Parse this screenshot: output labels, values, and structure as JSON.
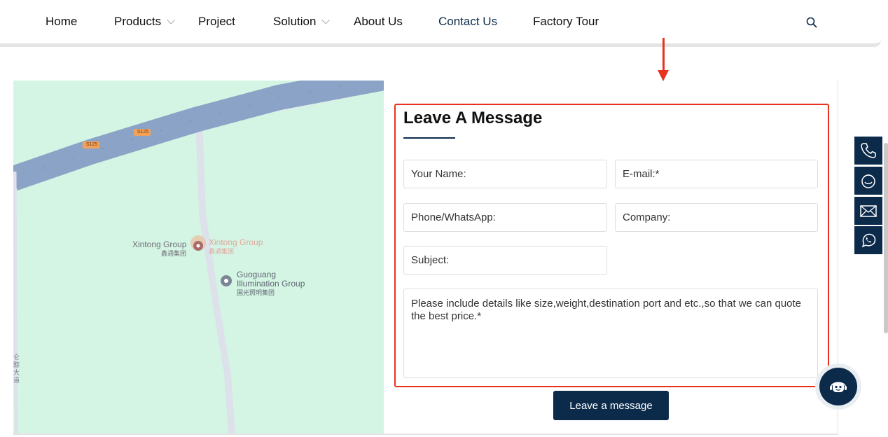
{
  "nav": {
    "items": [
      {
        "label": "Home"
      },
      {
        "label": "Products"
      },
      {
        "label": "Project"
      },
      {
        "label": "Solution"
      },
      {
        "label": "About Us"
      },
      {
        "label": "Contact Us"
      },
      {
        "label": "Factory Tour"
      }
    ],
    "search_icon": "search-icon"
  },
  "map": {
    "road_shield_1": "S125",
    "road_shield_2": "S125",
    "place1_name": "Xintong Group",
    "place1_sub": "鑫通集团",
    "place1_label_faded": "Xintong Group",
    "place1_sub_faded": "鑫通集团",
    "place2_line1": "Guoguang",
    "place2_line2": "Illumination Group",
    "place2_sub": "国光照明集团",
    "side_road": "仑黥大道"
  },
  "form": {
    "title": "Leave A Message",
    "name_placeholder": "Your Name:",
    "email_placeholder": "E-mail:*",
    "phone_placeholder": "Phone/WhatsApp:",
    "company_placeholder": "Company:",
    "subject_placeholder": "Subject:",
    "message_placeholder": "Please include details like size,weight,destination port and etc.,so that we can quote the best price.*",
    "submit_label": "Leave a message"
  },
  "sidebar": {
    "icons": [
      "phone-icon",
      "skype-icon",
      "email-icon",
      "whatsapp-icon"
    ]
  },
  "colors": {
    "brand": "#0c2b4b",
    "highlight": "#e8321e",
    "map_bg": "#d4f5e3",
    "highway": "#8ba3c6"
  }
}
